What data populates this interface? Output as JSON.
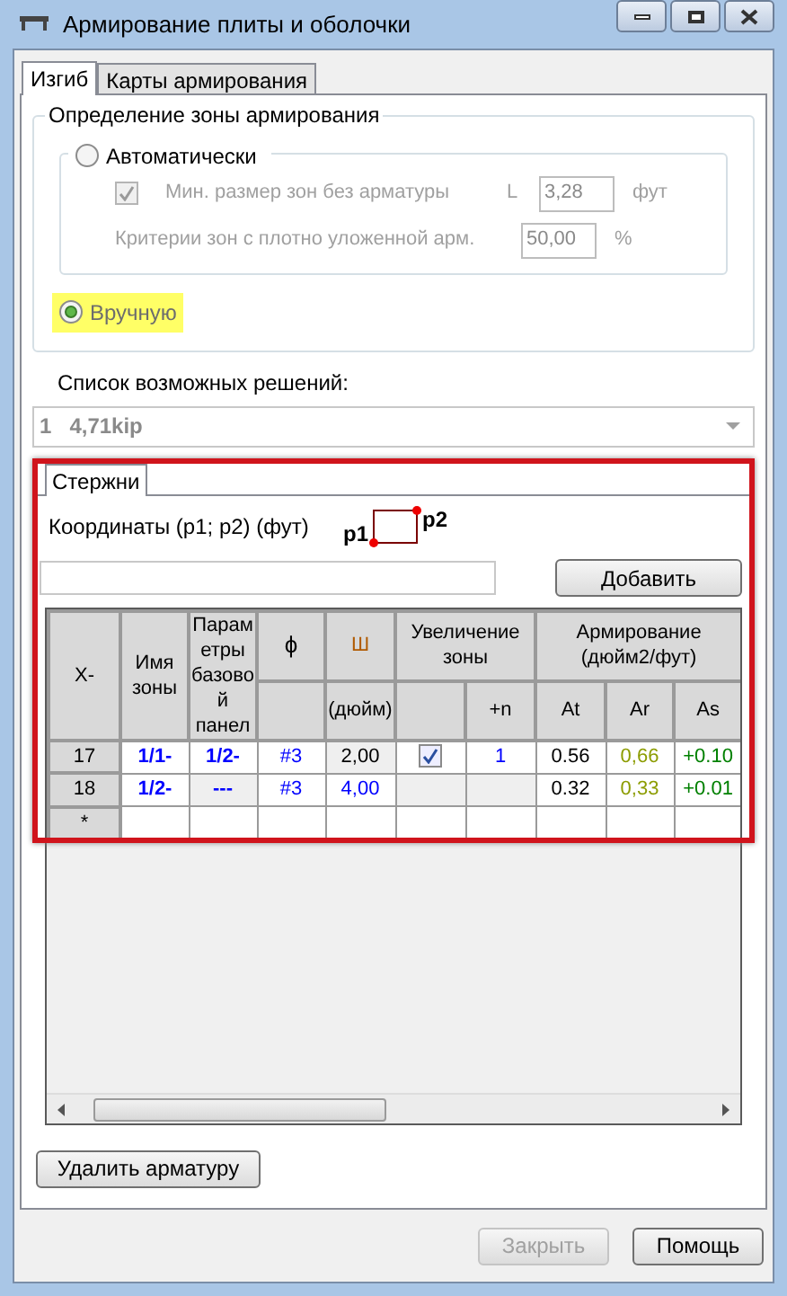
{
  "window": {
    "title": "Армирование плиты и оболочки"
  },
  "tabs": [
    {
      "label": "Изгиб",
      "selected": true
    },
    {
      "label": "Карты армирования",
      "selected": false
    }
  ],
  "zone_group": {
    "title": "Определение зоны армирования",
    "options": [
      {
        "label": "Автоматически",
        "selected": false,
        "highlighted": false
      },
      {
        "label": "Вручную",
        "selected": true,
        "highlighted": true
      }
    ],
    "min_size": {
      "label": "Мин. размер зон без арматуры",
      "checked": true,
      "disabled": true,
      "symbol": "L",
      "value": "3,28",
      "unit": "фут"
    },
    "criteria": {
      "label": "Критерии зон с плотно уложенной арм.",
      "value": "50,00",
      "unit": "%"
    }
  },
  "solutions": {
    "label": "Список возможных решений:",
    "index": "1",
    "value": "4,71kip"
  },
  "bars": {
    "highlighted": true,
    "tab": "Стержни",
    "coords_label": "Координаты (p1; p2) (фут)",
    "p1": "p1",
    "p2": "p2",
    "add_button": "Добавить",
    "grid": {
      "columns": [
        {
          "label": "X-",
          "kind": "single"
        },
        {
          "label": "Имя зоны",
          "kind": "single"
        },
        {
          "label": "Параметры базовой панел",
          "kind": "single"
        },
        {
          "label": "ϕ",
          "kind": "group"
        },
        {
          "label": "Ш",
          "kind": "group",
          "subs": [
            "(дюйм)"
          ]
        },
        {
          "label": "Увеличение зоны",
          "kind": "group",
          "colspan": 2,
          "subs": [
            "+n"
          ]
        },
        {
          "label": "Армирование (дюйм2/фут)",
          "kind": "group",
          "colspan": 3,
          "subs": [
            "At",
            "Ar",
            "As"
          ]
        }
      ],
      "rows": [
        {
          "cells": [
            {
              "kind": "header",
              "text": "17"
            },
            {
              "kind": "text",
              "text": "1/1-",
              "color": "#0000ff",
              "bold": true,
              "shaded": false
            },
            {
              "kind": "text",
              "text": "1/2-",
              "color": "#0000ff",
              "bold": true,
              "shaded": false
            },
            {
              "kind": "text",
              "text": "#3",
              "color": "#0000ff",
              "bold": false,
              "shaded": false
            },
            {
              "kind": "text",
              "text": "2,00",
              "color": "#000000",
              "bold": false,
              "shaded": true
            },
            {
              "kind": "check",
              "checked": true,
              "shaded": false
            },
            {
              "kind": "text",
              "text": "1",
              "color": "#0000ff",
              "bold": false,
              "shaded": false
            },
            {
              "kind": "text",
              "text": "0.56",
              "color": "#000000",
              "bold": false,
              "shaded": false
            },
            {
              "kind": "text",
              "text": "0,66",
              "color": "#8c9c00",
              "bold": false,
              "shaded": false
            },
            {
              "kind": "text",
              "text": "+0.10",
              "color": "#008000",
              "bold": false,
              "shaded": false
            }
          ]
        },
        {
          "cells": [
            {
              "kind": "header",
              "text": "18"
            },
            {
              "kind": "text",
              "text": "1/2-",
              "color": "#0000ff",
              "bold": true,
              "shaded": false
            },
            {
              "kind": "text",
              "text": "---",
              "color": "#0000ff",
              "bold": true,
              "shaded": true
            },
            {
              "kind": "text",
              "text": "#3",
              "color": "#0000ff",
              "bold": false,
              "shaded": false
            },
            {
              "kind": "text",
              "text": "4,00",
              "color": "#0000ff",
              "bold": false,
              "shaded": false
            },
            {
              "kind": "empty",
              "shaded": true
            },
            {
              "kind": "empty",
              "shaded": true
            },
            {
              "kind": "text",
              "text": "0.32",
              "color": "#000000",
              "bold": false,
              "shaded": false
            },
            {
              "kind": "text",
              "text": "0,33",
              "color": "#8c9c00",
              "bold": false,
              "shaded": false
            },
            {
              "kind": "text",
              "text": "+0.01",
              "color": "#008000",
              "bold": false,
              "shaded": false
            }
          ]
        }
      ],
      "new_row": "*"
    },
    "delete_button": "Удалить арматуру"
  },
  "buttons": [
    {
      "label": "Закрыть",
      "disabled": true
    },
    {
      "label": "Помощь",
      "disabled": false
    }
  ]
}
